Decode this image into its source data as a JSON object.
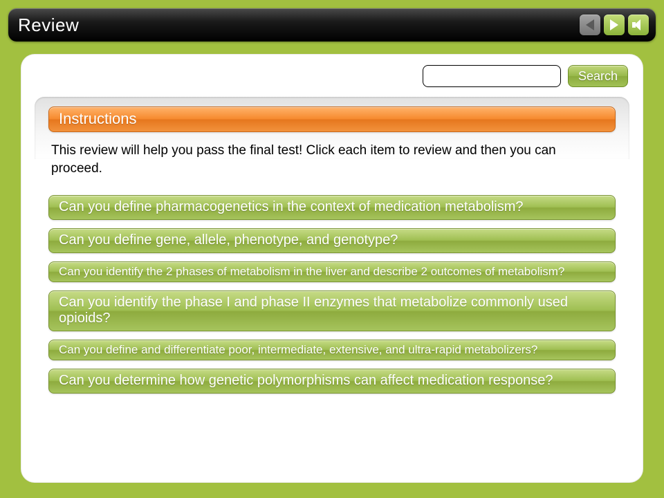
{
  "header": {
    "title": "Review"
  },
  "search": {
    "value": "",
    "placeholder": "",
    "button_label": "Search"
  },
  "instructions": {
    "heading": "Instructions",
    "body": "This review will help you pass the final test! Click each item to review and then you can proceed."
  },
  "items": [
    {
      "label": "Can you define pharmacogenetics in the context of medication metabolism?",
      "size": "lg"
    },
    {
      "label": "Can you define gene, allele, phenotype, and genotype?",
      "size": "lg"
    },
    {
      "label": "Can you identify the 2 phases of metabolism in the liver and describe 2 outcomes of metabolism?",
      "size": "sm"
    },
    {
      "label": "Can you identify the phase I and phase II enzymes that metabolize commonly used opioids?",
      "size": "lg"
    },
    {
      "label": "Can you define and differentiate poor, intermediate, extensive, and ultra-rapid metabolizers?",
      "size": "sm"
    },
    {
      "label": "Can you determine how genetic polymorphisms can affect medication response?",
      "size": "lg"
    }
  ],
  "nav": {
    "prev_enabled": false,
    "next_enabled": true,
    "audio_enabled": true
  }
}
